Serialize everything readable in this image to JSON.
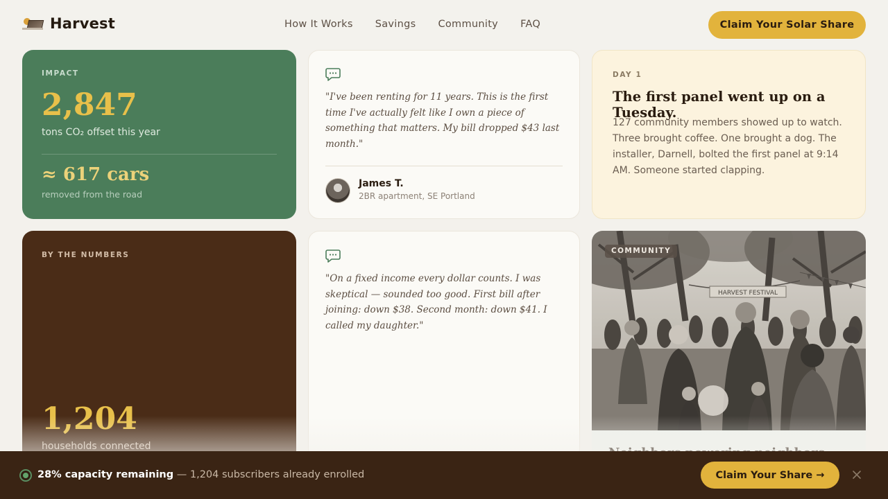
{
  "header": {
    "brand": "Harvest",
    "nav": [
      {
        "label": "How It Works"
      },
      {
        "label": "Savings"
      },
      {
        "label": "Community"
      },
      {
        "label": "FAQ"
      }
    ],
    "cta_label": "Claim Your Solar Share"
  },
  "impact": {
    "eyebrow": "IMPACT",
    "value": "2,847",
    "subtitle": "tons CO₂ offset this year",
    "cars": "≈ 617 cars",
    "cars_subtitle": "removed from the road"
  },
  "testimonial_1": {
    "quote": "\"I've been renting for 11 years. This is the first time I've actually felt like I own a piece of something that matters. My bill dropped $43 last month.\"",
    "author_name": "James T.",
    "author_location": "2BR apartment, SE Portland"
  },
  "day1": {
    "eyebrow": "DAY 1",
    "headline": "The first panel went up on a Tuesday.",
    "body": "127 community members showed up to watch. Three brought coffee. One brought a dog. The installer, Darnell, bolted the first panel at 9:14 AM. Someone started clapping."
  },
  "numbers": {
    "eyebrow": "BY THE NUMBERS",
    "value": "1,204",
    "subtitle": "households connected"
  },
  "testimonial_2": {
    "quote": "\"On a fixed income every dollar counts. I was skeptical — sounded too good. First bill after joining: down $38. Second month: down $41. I called my daughter.\""
  },
  "photo": {
    "tag": "COMMUNITY",
    "banner_text": "HARVEST FESTIVAL",
    "caption": "Neighbors powering neighbors"
  },
  "bottom_bar": {
    "capacity": "28% capacity remaining",
    "detail": " — 1,204 subscribers already enrolled",
    "cta_label": "Claim Your Share →"
  },
  "colors": {
    "accent": "#e2b33c",
    "green": "#4b7d5a",
    "brown": "#4a2c17",
    "cream": "#fcf3de"
  }
}
